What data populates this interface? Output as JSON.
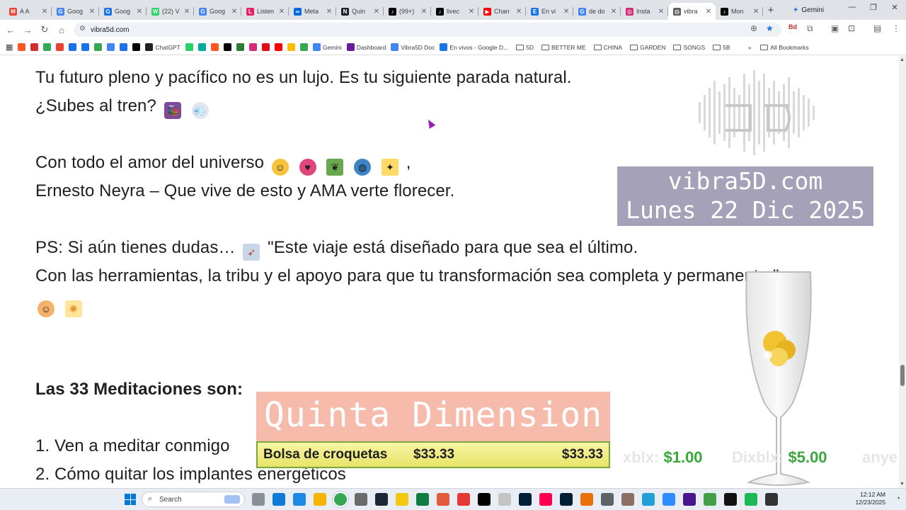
{
  "tabs": [
    {
      "title": "A A",
      "color": "#ea4335",
      "letter": "M"
    },
    {
      "title": "Goog",
      "color": "#4285f4",
      "letter": "G"
    },
    {
      "title": "Goog",
      "color": "#1a73e8",
      "letter": "G"
    },
    {
      "title": "(22) V",
      "color": "#25d366",
      "letter": "W"
    },
    {
      "title": "Goog",
      "color": "#4285f4",
      "letter": "G"
    },
    {
      "title": "Listen",
      "color": "#e91e63",
      "letter": "L"
    },
    {
      "title": "Meta",
      "color": "#0668e1",
      "letter": "∞"
    },
    {
      "title": "Quin",
      "color": "#202124",
      "letter": "N"
    },
    {
      "title": "(99+)",
      "color": "#000000",
      "letter": "♪"
    },
    {
      "title": "livec",
      "color": "#000000",
      "letter": "♪"
    },
    {
      "title": "Chan",
      "color": "#ff0000",
      "letter": "▶"
    },
    {
      "title": "En vi",
      "color": "#1a73e8",
      "letter": "E"
    },
    {
      "title": "de do",
      "color": "#4285f4",
      "letter": "G"
    },
    {
      "title": "Insta",
      "color": "#d62976",
      "letter": "◎"
    },
    {
      "title": "vibra",
      "color": "#5f6368",
      "letter": "◍",
      "active": true
    },
    {
      "title": "Mon",
      "color": "#000000",
      "letter": "♪"
    }
  ],
  "gemini_tab": "Gemini",
  "address": "vibra5d.com",
  "bookmarks": [
    {
      "label": "",
      "color": "#ff5722"
    },
    {
      "label": "",
      "color": "#d32f2f"
    },
    {
      "label": "",
      "color": "#34a853"
    },
    {
      "label": "",
      "color": "#ea4335"
    },
    {
      "label": "",
      "color": "#1a73e8"
    },
    {
      "label": "",
      "color": "#1a73e8"
    },
    {
      "label": "",
      "color": "#34a853"
    },
    {
      "label": "",
      "color": "#4285f4"
    },
    {
      "label": "",
      "color": "#1a73e8"
    },
    {
      "label": "",
      "color": "#000000"
    },
    {
      "label": "ChatGPT",
      "color": "#202124"
    },
    {
      "label": "",
      "color": "#25d366"
    },
    {
      "label": "",
      "color": "#00a99d"
    },
    {
      "label": "",
      "color": "#ff5722"
    },
    {
      "label": "",
      "color": "#000000"
    },
    {
      "label": "",
      "color": "#2e7d32"
    },
    {
      "label": "",
      "color": "#d62976"
    },
    {
      "label": "",
      "color": "#e50914"
    },
    {
      "label": "",
      "color": "#ff0000"
    },
    {
      "label": "",
      "color": "#fbbc04"
    },
    {
      "label": "",
      "color": "#34a853"
    },
    {
      "label": "Gemini",
      "color": "#4285f4"
    },
    {
      "label": "Dashboard",
      "color": "#6a1b9a"
    },
    {
      "label": "Vibra5D Doc",
      "color": "#4285f4"
    },
    {
      "label": "En vivos - Google D...",
      "color": "#1a73e8"
    }
  ],
  "bookmark_folders": [
    "5D",
    "BETTER ME",
    "CHINA",
    "GARDEN",
    "SONGS",
    "5B"
  ],
  "all_bookmarks": "All Bookmarks",
  "content": {
    "line1": "Tu futuro pleno y pacífico no es un lujo. Es tu siguiente parada natural.",
    "line2": "¿Subes al tren?",
    "line3": "Con todo el amor del universo",
    "line3_end": ",",
    "line4": "Ernesto Neyra – Que vive de esto y AMA verte florecer.",
    "line5_a": "PS: Si aún tienes dudas…",
    "line5_b": "\"Este viaje está diseñado para que sea el último.",
    "line6": "Con las herramientas, la tribu y el apoyo para que tu transformación sea completa y permanente.\"",
    "heading": "Las 33 Meditaciones son:",
    "item1": "1. Ven a meditar conmigo",
    "item2": "2. Cómo quitar los implantes energéticos"
  },
  "overlay": {
    "site": "vibra5D.com",
    "date": "Lunes 22 Dic 2025",
    "brand": "Quinta Dimension",
    "product": "Bolsa de croquetas",
    "price1": "$33.33",
    "price2": "$33.33",
    "ticker1_label": "xblx:",
    "ticker1_value": "$1.00",
    "ticker2_label": "Dixblx:",
    "ticker2_value": "$5.00",
    "ticker3_label": "anye"
  },
  "taskbar": {
    "search_placeholder": "Search",
    "time": "12:12 AM",
    "date": "12/23/2025"
  }
}
